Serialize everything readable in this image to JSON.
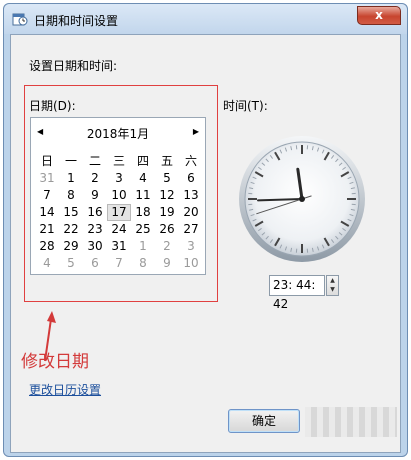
{
  "window": {
    "title": "日期和时间设置",
    "close_glyph": "x"
  },
  "dialog": {
    "heading": "设置日期和时间:",
    "date_label": "日期(D):",
    "time_label": "时间(T):"
  },
  "calendar": {
    "prev_glyph": "◀",
    "next_glyph": "▶",
    "month_title": "2018年1月",
    "weekdays": [
      "日",
      "一",
      "二",
      "三",
      "四",
      "五",
      "六"
    ],
    "days": [
      {
        "d": "31",
        "other": true
      },
      {
        "d": "1"
      },
      {
        "d": "2"
      },
      {
        "d": "3"
      },
      {
        "d": "4"
      },
      {
        "d": "5"
      },
      {
        "d": "6"
      },
      {
        "d": "7"
      },
      {
        "d": "8"
      },
      {
        "d": "9"
      },
      {
        "d": "10"
      },
      {
        "d": "11"
      },
      {
        "d": "12"
      },
      {
        "d": "13"
      },
      {
        "d": "14"
      },
      {
        "d": "15"
      },
      {
        "d": "16"
      },
      {
        "d": "17",
        "selected": true
      },
      {
        "d": "18"
      },
      {
        "d": "19"
      },
      {
        "d": "20"
      },
      {
        "d": "21"
      },
      {
        "d": "22"
      },
      {
        "d": "23"
      },
      {
        "d": "24"
      },
      {
        "d": "25"
      },
      {
        "d": "26"
      },
      {
        "d": "27"
      },
      {
        "d": "28"
      },
      {
        "d": "29"
      },
      {
        "d": "30"
      },
      {
        "d": "31"
      },
      {
        "d": "1",
        "other": true
      },
      {
        "d": "2",
        "other": true
      },
      {
        "d": "3",
        "other": true
      },
      {
        "d": "4",
        "other": true
      },
      {
        "d": "5",
        "other": true
      },
      {
        "d": "6",
        "other": true
      },
      {
        "d": "7",
        "other": true
      },
      {
        "d": "8",
        "other": true
      },
      {
        "d": "9",
        "other": true
      },
      {
        "d": "10",
        "other": true
      }
    ]
  },
  "clock": {
    "hour": 23,
    "minute": 44,
    "second": 42
  },
  "time_value": "23: 44: 42",
  "annotation": {
    "text": "修改日期",
    "color": "#d33a3a"
  },
  "link_text": "更改日历设置",
  "ok_label": "确定",
  "icons": {
    "app_icon": "calendar-clock-icon",
    "spin_up": "▲",
    "spin_down": "▼"
  },
  "colors": {
    "accent_red": "#e04040",
    "link_blue": "#1c4f9c"
  }
}
